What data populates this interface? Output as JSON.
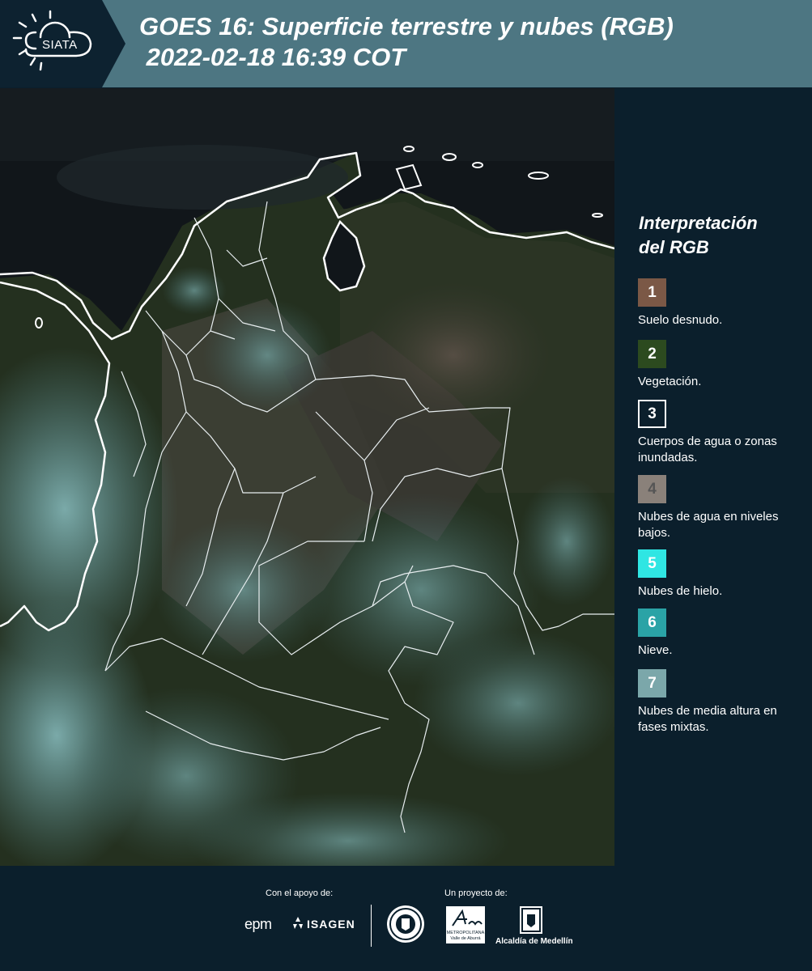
{
  "header": {
    "logo_text": "SIATA",
    "title_line1": "GOES 16: Superficie terrestre y nubes (RGB)",
    "title_line2": " 2022-02-18 16:39 COT"
  },
  "legend": {
    "title_line1": "Interpretación",
    "title_line2": "del RGB",
    "items": [
      {
        "number": "1",
        "label": "Suelo desnudo.",
        "color": "#7b5846",
        "text_color": "#ffffff"
      },
      {
        "number": "2",
        "label": "Vegetación.",
        "color": "#2c4a1f",
        "text_color": "#ffffff"
      },
      {
        "number": "3",
        "label": "Cuerpos de agua o zonas inundadas.",
        "color": "#0b1f2c",
        "text_color": "#ffffff",
        "border": "#ffffff"
      },
      {
        "number": "4",
        "label": "Nubes de agua en niveles bajos.",
        "color": "#8a817a",
        "text_color": "#555555"
      },
      {
        "number": "5",
        "label": "Nubes de hielo.",
        "color": "#2fe6e3",
        "text_color": "#ffffff"
      },
      {
        "number": "6",
        "label": "Nieve.",
        "color": "#2aa3a6",
        "text_color": "#ffffff"
      },
      {
        "number": "7",
        "label": "Nubes de media altura en fases mixtas.",
        "color": "#7ba7aa",
        "text_color": "#ffffff"
      }
    ]
  },
  "footer": {
    "support_label": "Con el apoyo de:",
    "project_label": "Un proyecto de:",
    "sponsor_epm": "epm",
    "sponsor_isagen": "ISAGEN",
    "area_name": "METROPOLITANA",
    "area_sub": "Valle de Aburrá",
    "alcaldia": "Alcaldía de Medellín"
  }
}
